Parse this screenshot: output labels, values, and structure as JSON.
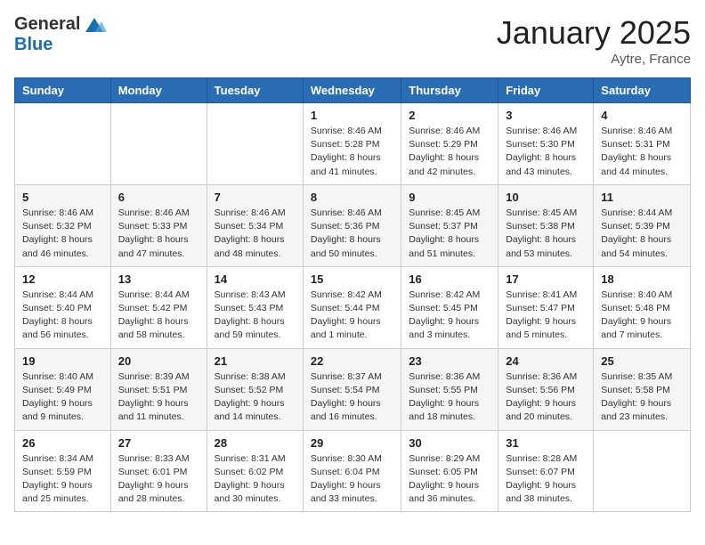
{
  "logo": {
    "general": "General",
    "blue": "Blue"
  },
  "header": {
    "month": "January 2025",
    "location": "Aytre, France"
  },
  "weekdays": [
    "Sunday",
    "Monday",
    "Tuesday",
    "Wednesday",
    "Thursday",
    "Friday",
    "Saturday"
  ],
  "weeks": [
    [
      {
        "day": "",
        "info": ""
      },
      {
        "day": "",
        "info": ""
      },
      {
        "day": "",
        "info": ""
      },
      {
        "day": "1",
        "info": "Sunrise: 8:46 AM\nSunset: 5:28 PM\nDaylight: 8 hours\nand 41 minutes."
      },
      {
        "day": "2",
        "info": "Sunrise: 8:46 AM\nSunset: 5:29 PM\nDaylight: 8 hours\nand 42 minutes."
      },
      {
        "day": "3",
        "info": "Sunrise: 8:46 AM\nSunset: 5:30 PM\nDaylight: 8 hours\nand 43 minutes."
      },
      {
        "day": "4",
        "info": "Sunrise: 8:46 AM\nSunset: 5:31 PM\nDaylight: 8 hours\nand 44 minutes."
      }
    ],
    [
      {
        "day": "5",
        "info": "Sunrise: 8:46 AM\nSunset: 5:32 PM\nDaylight: 8 hours\nand 46 minutes."
      },
      {
        "day": "6",
        "info": "Sunrise: 8:46 AM\nSunset: 5:33 PM\nDaylight: 8 hours\nand 47 minutes."
      },
      {
        "day": "7",
        "info": "Sunrise: 8:46 AM\nSunset: 5:34 PM\nDaylight: 8 hours\nand 48 minutes."
      },
      {
        "day": "8",
        "info": "Sunrise: 8:46 AM\nSunset: 5:36 PM\nDaylight: 8 hours\nand 50 minutes."
      },
      {
        "day": "9",
        "info": "Sunrise: 8:45 AM\nSunset: 5:37 PM\nDaylight: 8 hours\nand 51 minutes."
      },
      {
        "day": "10",
        "info": "Sunrise: 8:45 AM\nSunset: 5:38 PM\nDaylight: 8 hours\nand 53 minutes."
      },
      {
        "day": "11",
        "info": "Sunrise: 8:44 AM\nSunset: 5:39 PM\nDaylight: 8 hours\nand 54 minutes."
      }
    ],
    [
      {
        "day": "12",
        "info": "Sunrise: 8:44 AM\nSunset: 5:40 PM\nDaylight: 8 hours\nand 56 minutes."
      },
      {
        "day": "13",
        "info": "Sunrise: 8:44 AM\nSunset: 5:42 PM\nDaylight: 8 hours\nand 58 minutes."
      },
      {
        "day": "14",
        "info": "Sunrise: 8:43 AM\nSunset: 5:43 PM\nDaylight: 8 hours\nand 59 minutes."
      },
      {
        "day": "15",
        "info": "Sunrise: 8:42 AM\nSunset: 5:44 PM\nDaylight: 9 hours\nand 1 minute."
      },
      {
        "day": "16",
        "info": "Sunrise: 8:42 AM\nSunset: 5:45 PM\nDaylight: 9 hours\nand 3 minutes."
      },
      {
        "day": "17",
        "info": "Sunrise: 8:41 AM\nSunset: 5:47 PM\nDaylight: 9 hours\nand 5 minutes."
      },
      {
        "day": "18",
        "info": "Sunrise: 8:40 AM\nSunset: 5:48 PM\nDaylight: 9 hours\nand 7 minutes."
      }
    ],
    [
      {
        "day": "19",
        "info": "Sunrise: 8:40 AM\nSunset: 5:49 PM\nDaylight: 9 hours\nand 9 minutes."
      },
      {
        "day": "20",
        "info": "Sunrise: 8:39 AM\nSunset: 5:51 PM\nDaylight: 9 hours\nand 11 minutes."
      },
      {
        "day": "21",
        "info": "Sunrise: 8:38 AM\nSunset: 5:52 PM\nDaylight: 9 hours\nand 14 minutes."
      },
      {
        "day": "22",
        "info": "Sunrise: 8:37 AM\nSunset: 5:54 PM\nDaylight: 9 hours\nand 16 minutes."
      },
      {
        "day": "23",
        "info": "Sunrise: 8:36 AM\nSunset: 5:55 PM\nDaylight: 9 hours\nand 18 minutes."
      },
      {
        "day": "24",
        "info": "Sunrise: 8:36 AM\nSunset: 5:56 PM\nDaylight: 9 hours\nand 20 minutes."
      },
      {
        "day": "25",
        "info": "Sunrise: 8:35 AM\nSunset: 5:58 PM\nDaylight: 9 hours\nand 23 minutes."
      }
    ],
    [
      {
        "day": "26",
        "info": "Sunrise: 8:34 AM\nSunset: 5:59 PM\nDaylight: 9 hours\nand 25 minutes."
      },
      {
        "day": "27",
        "info": "Sunrise: 8:33 AM\nSunset: 6:01 PM\nDaylight: 9 hours\nand 28 minutes."
      },
      {
        "day": "28",
        "info": "Sunrise: 8:31 AM\nSunset: 6:02 PM\nDaylight: 9 hours\nand 30 minutes."
      },
      {
        "day": "29",
        "info": "Sunrise: 8:30 AM\nSunset: 6:04 PM\nDaylight: 9 hours\nand 33 minutes."
      },
      {
        "day": "30",
        "info": "Sunrise: 8:29 AM\nSunset: 6:05 PM\nDaylight: 9 hours\nand 36 minutes."
      },
      {
        "day": "31",
        "info": "Sunrise: 8:28 AM\nSunset: 6:07 PM\nDaylight: 9 hours\nand 38 minutes."
      },
      {
        "day": "",
        "info": ""
      }
    ]
  ]
}
